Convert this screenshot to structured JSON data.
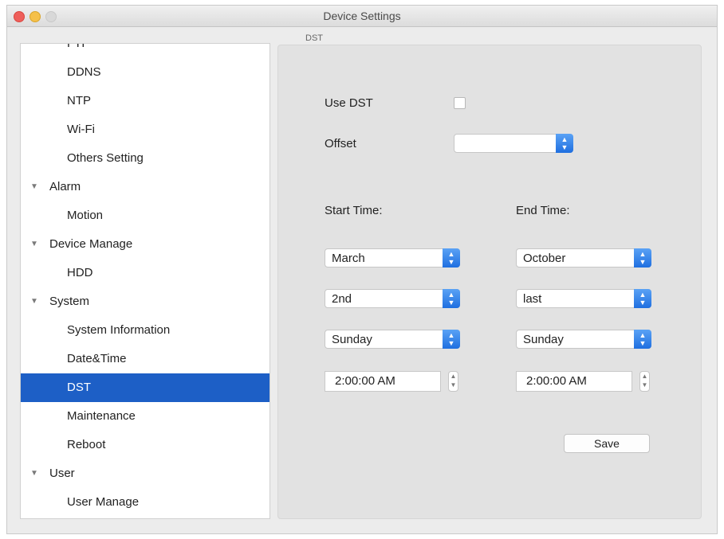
{
  "window": {
    "title": "Device Settings"
  },
  "sidebar": {
    "partial_top": "FTP",
    "items": [
      {
        "label": "DDNS",
        "type": "child"
      },
      {
        "label": "NTP",
        "type": "child"
      },
      {
        "label": "Wi-Fi",
        "type": "child"
      },
      {
        "label": "Others Setting",
        "type": "child"
      },
      {
        "label": "Alarm",
        "type": "group",
        "expanded": true
      },
      {
        "label": "Motion",
        "type": "child"
      },
      {
        "label": "Device Manage",
        "type": "group",
        "expanded": true
      },
      {
        "label": "HDD",
        "type": "child"
      },
      {
        "label": "System",
        "type": "group",
        "expanded": true
      },
      {
        "label": "System Information",
        "type": "child"
      },
      {
        "label": "Date&Time",
        "type": "child"
      },
      {
        "label": "DST",
        "type": "child",
        "selected": true
      },
      {
        "label": "Maintenance",
        "type": "child"
      },
      {
        "label": "Reboot",
        "type": "child"
      },
      {
        "label": "User",
        "type": "group",
        "expanded": true
      },
      {
        "label": "User Manage",
        "type": "child"
      }
    ]
  },
  "dst": {
    "group_title": "DST",
    "use_dst_label": "Use DST",
    "use_dst_checked": false,
    "offset_label": "Offset",
    "offset_value": "",
    "start_label": "Start Time:",
    "end_label": "End Time:",
    "start": {
      "month": "March",
      "week": "2nd",
      "day": "Sunday",
      "time": "2:00:00 AM"
    },
    "end": {
      "month": "October",
      "week": "last",
      "day": "Sunday",
      "time": "2:00:00 AM"
    },
    "save_label": "Save"
  },
  "colors": {
    "selection": "#1d5fc6",
    "popup_arrow": "#2f7fea"
  }
}
